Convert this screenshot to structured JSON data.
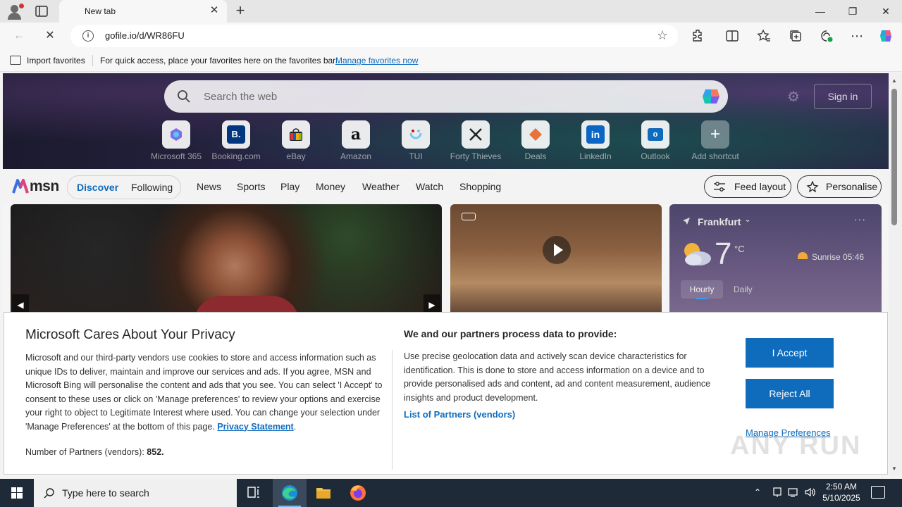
{
  "browser": {
    "tab_title": "New tab",
    "url": "gofile.io/d/WR86FU",
    "favorites_bar": {
      "import_label": "Import favorites",
      "hint": "For quick access, place your favorites here on the favorites bar.",
      "manage_link": "Manage favorites now"
    }
  },
  "newtab": {
    "search_placeholder": "Search the web",
    "signin_label": "Sign in",
    "shortcuts": [
      {
        "label": "Microsoft 365",
        "icon": "m365-icon"
      },
      {
        "label": "Booking.com",
        "icon": "booking-icon"
      },
      {
        "label": "eBay",
        "icon": "ebay-icon"
      },
      {
        "label": "Amazon",
        "icon": "amazon-icon"
      },
      {
        "label": "TUI",
        "icon": "tui-icon"
      },
      {
        "label": "Forty Thieves",
        "icon": "forty-thieves-icon"
      },
      {
        "label": "Deals",
        "icon": "deals-icon"
      },
      {
        "label": "LinkedIn",
        "icon": "linkedin-icon"
      },
      {
        "label": "Outlook",
        "icon": "outlook-icon"
      },
      {
        "label": "Add shortcut",
        "icon": "plus-icon"
      }
    ]
  },
  "msn": {
    "logo": "msn",
    "tabs": {
      "discover": "Discover",
      "following": "Following"
    },
    "nav": [
      "News",
      "Sports",
      "Play",
      "Money",
      "Weather",
      "Watch",
      "Shopping"
    ],
    "feed_layout": "Feed layout",
    "personalise": "Personalise"
  },
  "weather": {
    "location": "Frankfurt",
    "temperature": "7",
    "unit": "°C",
    "sunrise": "Sunrise 05:46",
    "tab_hourly": "Hourly",
    "tab_daily": "Daily"
  },
  "privacy": {
    "title": "Microsoft Cares About Your Privacy",
    "body": "Microsoft and our third-party vendors use cookies to store and access information such as unique IDs to deliver, maintain and improve our services and ads. If you agree, MSN and Microsoft Bing will personalise the content and ads that you see. You can select 'I Accept' to consent to these uses or click on 'Manage preferences' to review your options and exercise your right to object to Legitimate Interest where used.  You can change your selection under 'Manage Preferences' at the bottom of this page.",
    "privacy_link": "Privacy Statement",
    "partners_label": "Number of Partners (vendors):",
    "partners_count": "852.",
    "purposes_heading": "We and our partners process data to provide:",
    "purposes_text": "Use precise geolocation data and actively scan device characteristics for identification. This is done to store and access information on a device and to provide personalised ads and content, ad and content measurement, audience insights and product development.",
    "list_partners_link": "List of Partners (vendors)",
    "accept_label": "I Accept",
    "reject_label": "Reject All",
    "manage_label": "Manage Preferences"
  },
  "watermark": "ANY RUN",
  "taskbar": {
    "search_placeholder": "Type here to search",
    "time": "2:50 AM",
    "date": "5/10/2025"
  },
  "colors": {
    "accent": "#0f6cbd",
    "taskbar": "#1e2a37"
  }
}
